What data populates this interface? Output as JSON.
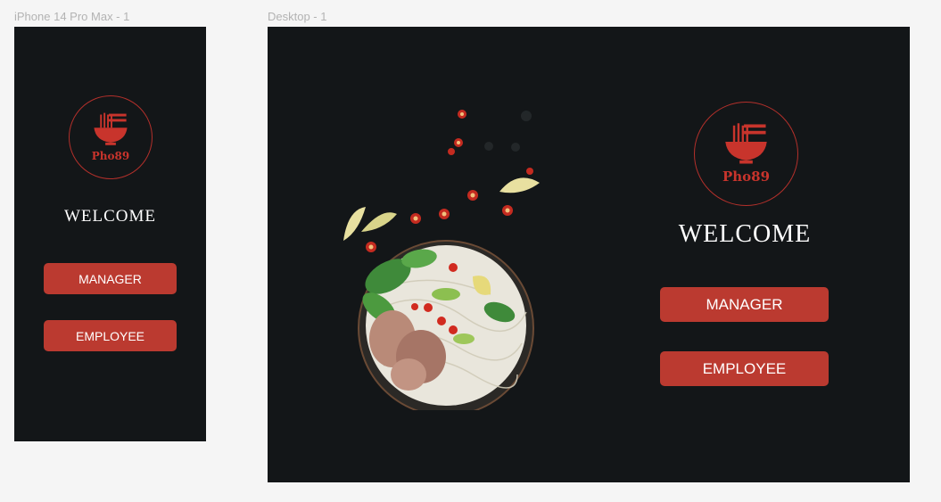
{
  "canvas": {
    "phone_frame_label": "iPhone 14 Pro Max - 1",
    "desktop_frame_label": "Desktop - 1"
  },
  "brand": {
    "name": "Pho89",
    "accent": "#c8342c",
    "background": "#131618"
  },
  "welcome_text": "WELCOME",
  "buttons": {
    "manager": "MANAGER",
    "employee": "EMPLOYEE"
  },
  "icons": {
    "logo": "noodle-bowl-chopsticks-icon"
  },
  "image": {
    "subject": "pho-bowl-photo"
  }
}
